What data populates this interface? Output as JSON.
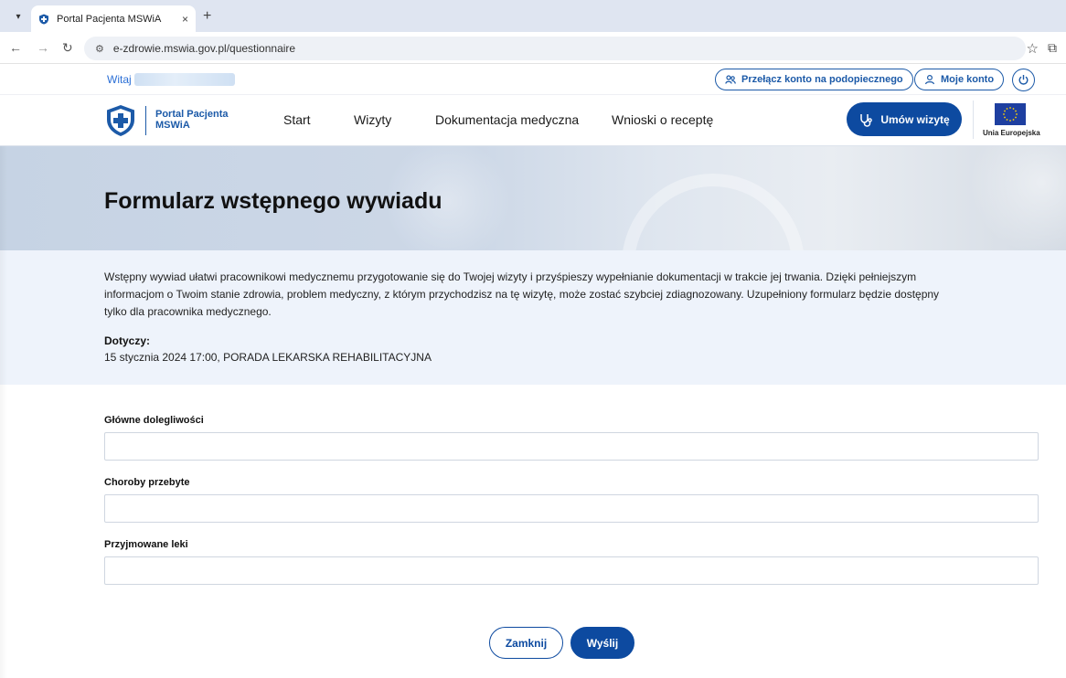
{
  "browser": {
    "tab_title": "Portal Pacjenta MSWiA",
    "tab_close": "×",
    "new_tab": "+",
    "url": "e-zdrowie.mswia.gov.pl/questionnaire"
  },
  "topbar": {
    "greeting": "Witaj",
    "switch_account": "Przełącz konto na podopiecznego",
    "my_account": "Moje konto"
  },
  "header": {
    "logo_line1": "Portal Pacjenta",
    "logo_line2": "MSWiA",
    "nav": [
      "Start",
      "Wizyty",
      "Dokumentacja medyczna",
      "Wnioski o receptę"
    ],
    "cta": "Umów wizytę",
    "eu_label": "Unia Europejska"
  },
  "hero": {
    "title": "Formularz wstępnego wywiadu"
  },
  "intro": {
    "text": "Wstępny wywiad ułatwi pracownikowi medycznemu przygotowanie się do Twojej wizyty i przyśpieszy wypełnianie dokumentacji w trakcie jej trwania. Dzięki pełniejszym informacjom o Twoim stanie zdrowia, problem medyczny, z którym przychodzisz na tę wizytę, może zostać szybciej zdiagnozowany. Uzupełniony formularz będzie dostępny tylko dla pracownika medycznego.",
    "concerns_label": "Dotyczy:",
    "concerns_value": "15 stycznia 2024 17:00, PORADA LEKARSKA REHABILITACYJNA"
  },
  "form": {
    "fields": [
      {
        "label": "Główne dolegliwości",
        "value": ""
      },
      {
        "label": "Choroby przebyte",
        "value": ""
      },
      {
        "label": "Przyjmowane leki",
        "value": ""
      }
    ],
    "close_label": "Zamknij",
    "submit_label": "Wyślij"
  },
  "colors": {
    "primary": "#0d4aa0",
    "link": "#1c5aa8",
    "intro_bg": "#eef3fb"
  }
}
